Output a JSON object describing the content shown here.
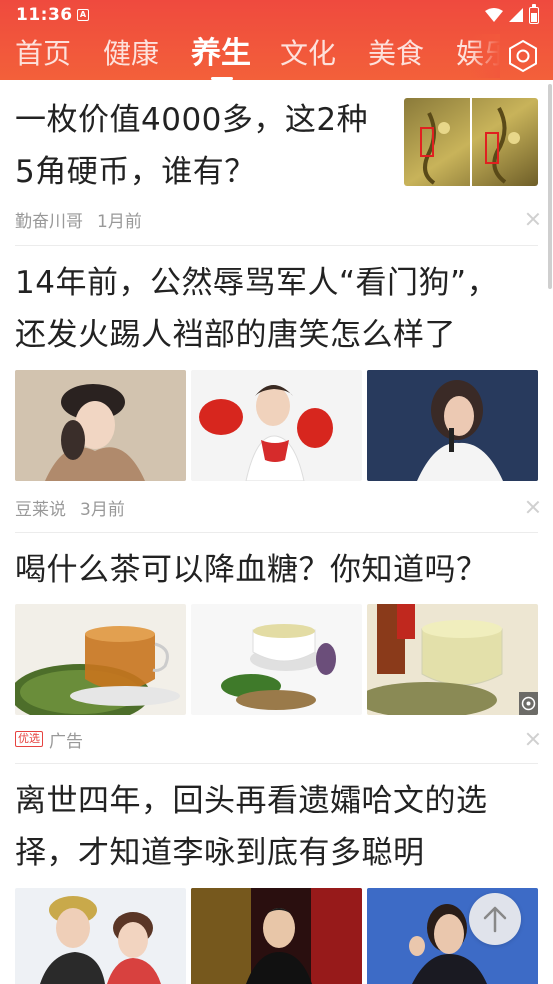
{
  "status_bar": {
    "time": "11:36",
    "app_icon_letter": "A"
  },
  "nav": {
    "tabs": [
      "首页",
      "健康",
      "养生",
      "文化",
      "美食",
      "娱乐"
    ],
    "active_tab": "养生"
  },
  "articles": [
    {
      "title_line1": "一枚价值4000多，这2种",
      "title_line2": "5角硬币，谁有？",
      "source": "勤奋川哥",
      "time": "1月前"
    },
    {
      "title_line1": "14年前，公然辱骂军人“看门狗”，",
      "title_line2": "还发火踢人裆部的唐笑怎么样了",
      "source": "豆莱说",
      "time": "3月前"
    },
    {
      "title_line1": "喝什么茶可以降血糖？你知道吗？",
      "badge": "优选",
      "label": "广告"
    },
    {
      "title_line1": "离世四年，回头再看遗孀哈文的选",
      "title_line2": "择，才知道李咏到底有多聪明"
    }
  ],
  "colors": {
    "header_red": "#ef4a3e",
    "header_orange": "#f3603a",
    "badge_red": "#e64340"
  }
}
